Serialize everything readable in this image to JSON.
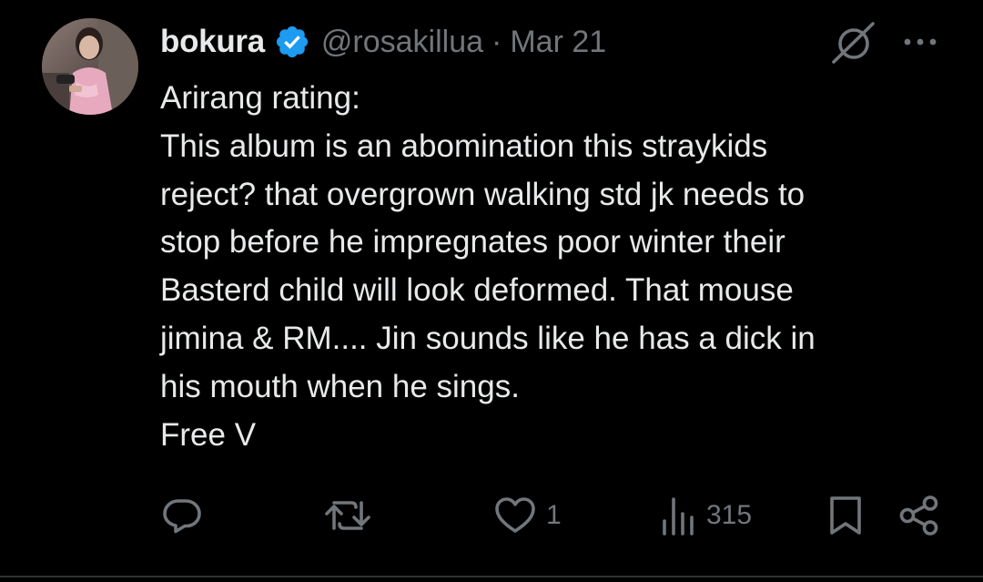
{
  "author": {
    "display_name": "bokura",
    "handle": "@rosakillua",
    "separator": "·",
    "date": "Mar 21",
    "verified_color": "#1d9bf0"
  },
  "post": {
    "lines": [
      "Arirang rating:",
      "This album is an abomination this straykids",
      "reject? that overgrown walking std jk needs to",
      "stop before he impregnates poor winter their",
      "Basterd child will look deformed. That mouse",
      "jimina & RM.... Jin sounds like he has a dick in",
      "his mouth when he sings.",
      "Free V"
    ]
  },
  "actions": {
    "reply_icon": "reply-icon",
    "repost_icon": "repost-icon",
    "like_icon": "heart-icon",
    "like_count": "1",
    "views_icon": "views-icon",
    "views_count": "315",
    "bookmark_icon": "bookmark-icon",
    "share_icon": "share-icon"
  },
  "colors": {
    "background": "#000000",
    "text_primary": "#e7e9ea",
    "text_secondary": "#71767b"
  }
}
